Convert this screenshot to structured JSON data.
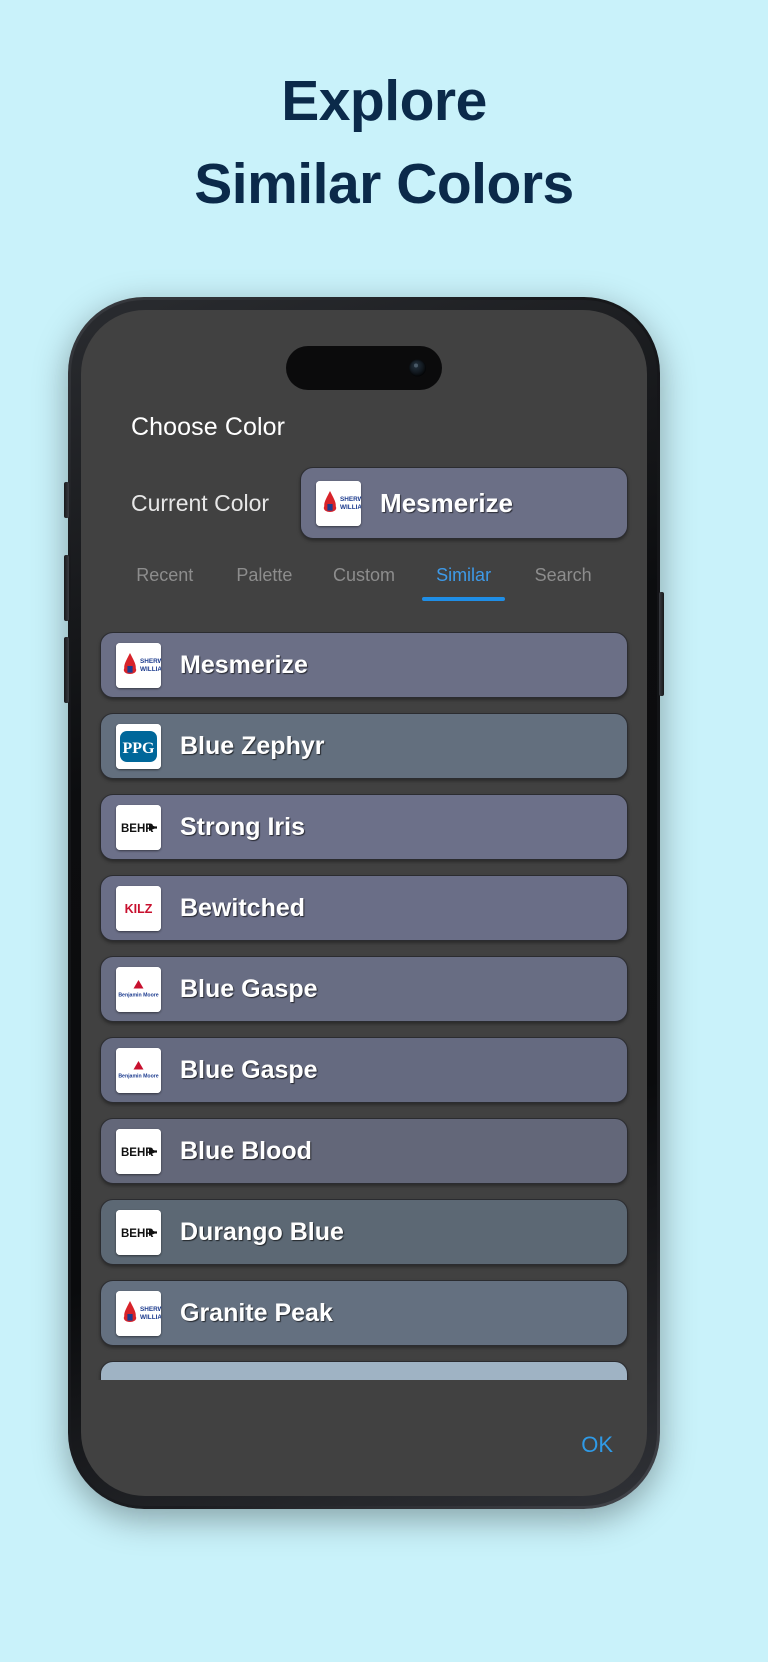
{
  "marketing": {
    "line1": "Explore",
    "line2": "Similar Colors",
    "background": "#c9f2fa",
    "text_color": "#0b2a4a"
  },
  "app": {
    "title": "Choose Color",
    "current_color_label": "Current Color",
    "current_color": {
      "name": "Mesmerize",
      "brand": "sherwin-williams",
      "swatch": "#6b6f86"
    },
    "tabs": [
      {
        "label": "Recent",
        "active": false
      },
      {
        "label": "Palette",
        "active": false
      },
      {
        "label": "Custom",
        "active": false
      },
      {
        "label": "Similar",
        "active": true
      },
      {
        "label": "Search",
        "active": false
      }
    ],
    "accent_color": "#1f8ee6",
    "ok_label": "OK",
    "rows": [
      {
        "name": "Mesmerize",
        "brand": "sherwin-williams",
        "swatch": "#6b6f86"
      },
      {
        "name": "Blue Zephyr",
        "brand": "ppg",
        "swatch": "#636f7e"
      },
      {
        "name": "Strong Iris",
        "brand": "behr",
        "swatch": "#6c7089"
      },
      {
        "name": "Bewitched",
        "brand": "kilz",
        "swatch": "#6a6e87"
      },
      {
        "name": "Blue Gaspe",
        "brand": "benjamin-moore",
        "swatch": "#686d83"
      },
      {
        "name": "Blue Gaspe",
        "brand": "benjamin-moore",
        "swatch": "#656a80"
      },
      {
        "name": "Blue Blood",
        "brand": "behr",
        "swatch": "#636779"
      },
      {
        "name": "Durango Blue",
        "brand": "behr",
        "swatch": "#5c6874"
      },
      {
        "name": "Granite Peak",
        "brand": "sherwin-williams",
        "swatch": "#647080"
      },
      {
        "name": "",
        "brand": "none",
        "swatch": "#9fb3c4"
      }
    ]
  }
}
